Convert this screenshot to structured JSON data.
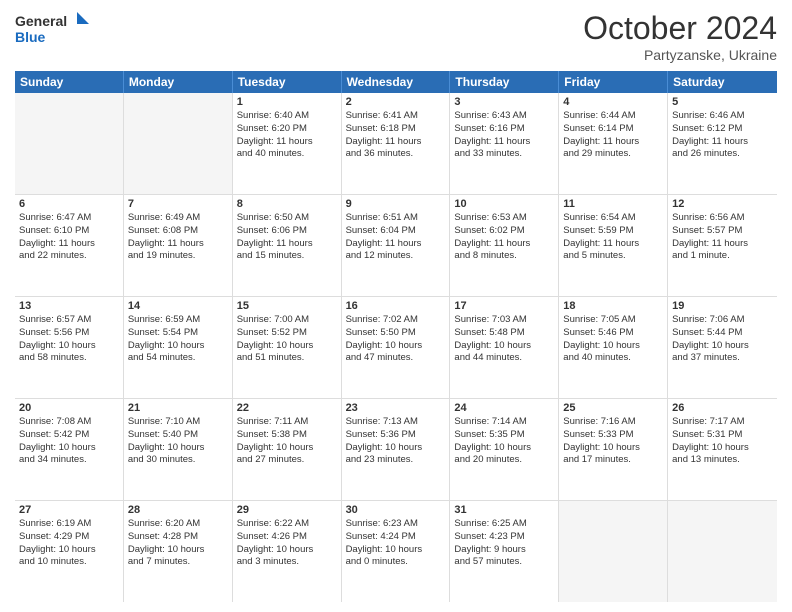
{
  "header": {
    "logo_general": "General",
    "logo_blue": "Blue",
    "title": "October 2024",
    "location": "Partyzanske, Ukraine"
  },
  "weekdays": [
    "Sunday",
    "Monday",
    "Tuesday",
    "Wednesday",
    "Thursday",
    "Friday",
    "Saturday"
  ],
  "rows": [
    [
      {
        "day": "",
        "empty": true,
        "lines": []
      },
      {
        "day": "",
        "empty": true,
        "lines": []
      },
      {
        "day": "1",
        "empty": false,
        "lines": [
          "Sunrise: 6:40 AM",
          "Sunset: 6:20 PM",
          "Daylight: 11 hours",
          "and 40 minutes."
        ]
      },
      {
        "day": "2",
        "empty": false,
        "lines": [
          "Sunrise: 6:41 AM",
          "Sunset: 6:18 PM",
          "Daylight: 11 hours",
          "and 36 minutes."
        ]
      },
      {
        "day": "3",
        "empty": false,
        "lines": [
          "Sunrise: 6:43 AM",
          "Sunset: 6:16 PM",
          "Daylight: 11 hours",
          "and 33 minutes."
        ]
      },
      {
        "day": "4",
        "empty": false,
        "lines": [
          "Sunrise: 6:44 AM",
          "Sunset: 6:14 PM",
          "Daylight: 11 hours",
          "and 29 minutes."
        ]
      },
      {
        "day": "5",
        "empty": false,
        "lines": [
          "Sunrise: 6:46 AM",
          "Sunset: 6:12 PM",
          "Daylight: 11 hours",
          "and 26 minutes."
        ]
      }
    ],
    [
      {
        "day": "6",
        "empty": false,
        "lines": [
          "Sunrise: 6:47 AM",
          "Sunset: 6:10 PM",
          "Daylight: 11 hours",
          "and 22 minutes."
        ]
      },
      {
        "day": "7",
        "empty": false,
        "lines": [
          "Sunrise: 6:49 AM",
          "Sunset: 6:08 PM",
          "Daylight: 11 hours",
          "and 19 minutes."
        ]
      },
      {
        "day": "8",
        "empty": false,
        "lines": [
          "Sunrise: 6:50 AM",
          "Sunset: 6:06 PM",
          "Daylight: 11 hours",
          "and 15 minutes."
        ]
      },
      {
        "day": "9",
        "empty": false,
        "lines": [
          "Sunrise: 6:51 AM",
          "Sunset: 6:04 PM",
          "Daylight: 11 hours",
          "and 12 minutes."
        ]
      },
      {
        "day": "10",
        "empty": false,
        "lines": [
          "Sunrise: 6:53 AM",
          "Sunset: 6:02 PM",
          "Daylight: 11 hours",
          "and 8 minutes."
        ]
      },
      {
        "day": "11",
        "empty": false,
        "lines": [
          "Sunrise: 6:54 AM",
          "Sunset: 5:59 PM",
          "Daylight: 11 hours",
          "and 5 minutes."
        ]
      },
      {
        "day": "12",
        "empty": false,
        "lines": [
          "Sunrise: 6:56 AM",
          "Sunset: 5:57 PM",
          "Daylight: 11 hours",
          "and 1 minute."
        ]
      }
    ],
    [
      {
        "day": "13",
        "empty": false,
        "lines": [
          "Sunrise: 6:57 AM",
          "Sunset: 5:56 PM",
          "Daylight: 10 hours",
          "and 58 minutes."
        ]
      },
      {
        "day": "14",
        "empty": false,
        "lines": [
          "Sunrise: 6:59 AM",
          "Sunset: 5:54 PM",
          "Daylight: 10 hours",
          "and 54 minutes."
        ]
      },
      {
        "day": "15",
        "empty": false,
        "lines": [
          "Sunrise: 7:00 AM",
          "Sunset: 5:52 PM",
          "Daylight: 10 hours",
          "and 51 minutes."
        ]
      },
      {
        "day": "16",
        "empty": false,
        "lines": [
          "Sunrise: 7:02 AM",
          "Sunset: 5:50 PM",
          "Daylight: 10 hours",
          "and 47 minutes."
        ]
      },
      {
        "day": "17",
        "empty": false,
        "lines": [
          "Sunrise: 7:03 AM",
          "Sunset: 5:48 PM",
          "Daylight: 10 hours",
          "and 44 minutes."
        ]
      },
      {
        "day": "18",
        "empty": false,
        "lines": [
          "Sunrise: 7:05 AM",
          "Sunset: 5:46 PM",
          "Daylight: 10 hours",
          "and 40 minutes."
        ]
      },
      {
        "day": "19",
        "empty": false,
        "lines": [
          "Sunrise: 7:06 AM",
          "Sunset: 5:44 PM",
          "Daylight: 10 hours",
          "and 37 minutes."
        ]
      }
    ],
    [
      {
        "day": "20",
        "empty": false,
        "lines": [
          "Sunrise: 7:08 AM",
          "Sunset: 5:42 PM",
          "Daylight: 10 hours",
          "and 34 minutes."
        ]
      },
      {
        "day": "21",
        "empty": false,
        "lines": [
          "Sunrise: 7:10 AM",
          "Sunset: 5:40 PM",
          "Daylight: 10 hours",
          "and 30 minutes."
        ]
      },
      {
        "day": "22",
        "empty": false,
        "lines": [
          "Sunrise: 7:11 AM",
          "Sunset: 5:38 PM",
          "Daylight: 10 hours",
          "and 27 minutes."
        ]
      },
      {
        "day": "23",
        "empty": false,
        "lines": [
          "Sunrise: 7:13 AM",
          "Sunset: 5:36 PM",
          "Daylight: 10 hours",
          "and 23 minutes."
        ]
      },
      {
        "day": "24",
        "empty": false,
        "lines": [
          "Sunrise: 7:14 AM",
          "Sunset: 5:35 PM",
          "Daylight: 10 hours",
          "and 20 minutes."
        ]
      },
      {
        "day": "25",
        "empty": false,
        "lines": [
          "Sunrise: 7:16 AM",
          "Sunset: 5:33 PM",
          "Daylight: 10 hours",
          "and 17 minutes."
        ]
      },
      {
        "day": "26",
        "empty": false,
        "lines": [
          "Sunrise: 7:17 AM",
          "Sunset: 5:31 PM",
          "Daylight: 10 hours",
          "and 13 minutes."
        ]
      }
    ],
    [
      {
        "day": "27",
        "empty": false,
        "lines": [
          "Sunrise: 6:19 AM",
          "Sunset: 4:29 PM",
          "Daylight: 10 hours",
          "and 10 minutes."
        ]
      },
      {
        "day": "28",
        "empty": false,
        "lines": [
          "Sunrise: 6:20 AM",
          "Sunset: 4:28 PM",
          "Daylight: 10 hours",
          "and 7 minutes."
        ]
      },
      {
        "day": "29",
        "empty": false,
        "lines": [
          "Sunrise: 6:22 AM",
          "Sunset: 4:26 PM",
          "Daylight: 10 hours",
          "and 3 minutes."
        ]
      },
      {
        "day": "30",
        "empty": false,
        "lines": [
          "Sunrise: 6:23 AM",
          "Sunset: 4:24 PM",
          "Daylight: 10 hours",
          "and 0 minutes."
        ]
      },
      {
        "day": "31",
        "empty": false,
        "lines": [
          "Sunrise: 6:25 AM",
          "Sunset: 4:23 PM",
          "Daylight: 9 hours",
          "and 57 minutes."
        ]
      },
      {
        "day": "",
        "empty": true,
        "lines": []
      },
      {
        "day": "",
        "empty": true,
        "lines": []
      }
    ]
  ]
}
